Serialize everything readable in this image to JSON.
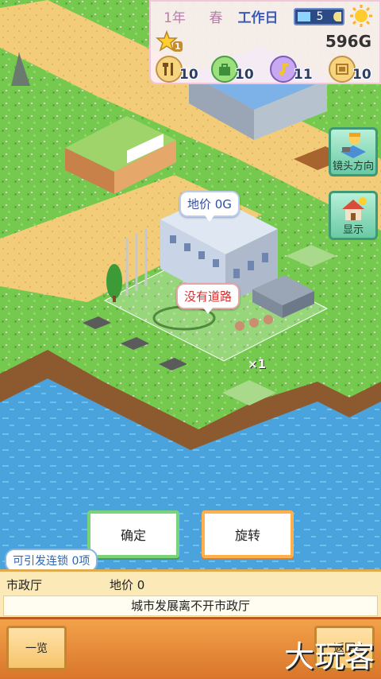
{
  "hud": {
    "year": "1年",
    "season": "春",
    "day_type": "工作日",
    "calendar_day": "5",
    "star_level": "1",
    "money": "596G",
    "stats": [
      {
        "icon": "fork-knife-icon",
        "value": "10"
      },
      {
        "icon": "shopping-bag-icon",
        "value": "10"
      },
      {
        "icon": "music-note-icon",
        "value": "11"
      },
      {
        "icon": "theater-icon",
        "value": "10"
      }
    ]
  },
  "side_buttons": {
    "camera": "镜头方向",
    "display": "显示"
  },
  "map": {
    "price_bubble": "地价 0G",
    "road_bubble": "没有道路",
    "multiplier": "×1"
  },
  "actions": {
    "confirm": "确定",
    "rotate": "旋转"
  },
  "chain_label": "可引发连锁 0项",
  "info": {
    "name": "市政厅",
    "price": "地价 0",
    "description": "城市发展离不开市政厅"
  },
  "bottom": {
    "list": "一览",
    "back": "返回"
  },
  "watermark": "大玩客",
  "colors": {
    "grass": "#6fc24a",
    "water": "#4aa0d8",
    "sand": "#f0c870",
    "accent_orange": "#f3a24a"
  }
}
